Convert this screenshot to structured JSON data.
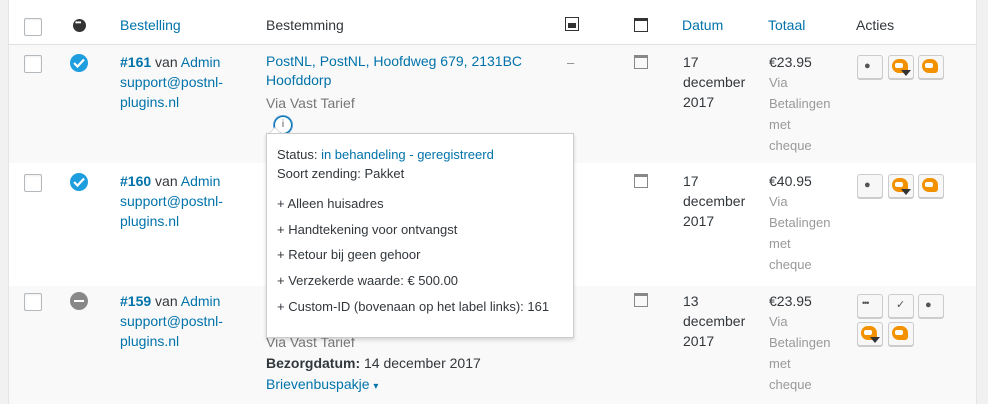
{
  "header": {
    "bestelling": "Bestelling",
    "bestemming": "Bestemming",
    "datum": "Datum",
    "totaal": "Totaal",
    "acties": "Acties"
  },
  "rows": [
    {
      "order_no": "#161",
      "van": "van",
      "customer": "Admin",
      "email_line1": "support@postnl-",
      "email_line2": "plugins.nl",
      "address_line1": "PostNL, PostNL, Hoofdweg 679, 2131BC",
      "address_line2": "Hoofddorp",
      "via": "Via Vast Tarief",
      "dash": "–",
      "date_line1": "17",
      "date_line2": "december",
      "date_line3": "2017",
      "total": "€23.95",
      "pay_line1": "Via",
      "pay_line2": "Betalingen",
      "pay_line3": "met",
      "pay_line4": "cheque"
    },
    {
      "order_no": "#160",
      "van": "van",
      "customer": "Admin",
      "email_line1": "support@postnl-",
      "email_line2": "plugins.nl",
      "date_line1": "17",
      "date_line2": "december",
      "date_line3": "2017",
      "total": "€40.95",
      "pay_line1": "Via",
      "pay_line2": "Betalingen",
      "pay_line3": "met",
      "pay_line4": "cheque"
    },
    {
      "order_no": "#159",
      "van": "van",
      "customer": "Admin",
      "email_line1": "support@postnl-",
      "email_line2": "plugins.nl",
      "via": "Via Vast Tarief",
      "bezorg_label": "Bezorgdatum:",
      "bezorg_value": " 14 december 2017",
      "package": "Brievenbuspakje",
      "package_caret": "▾",
      "date_line1": "13",
      "date_line2": "december",
      "date_line3": "2017",
      "total": "€23.95",
      "pay_line1": "Via",
      "pay_line2": "Betalingen",
      "pay_line3": "met",
      "pay_line4": "cheque"
    }
  ],
  "popup": {
    "status_label": "Status: ",
    "status_value": "in behandeling - geregistreerd",
    "soort": "Soort zending: Pakket",
    "opt1": "+ Alleen huisadres",
    "opt2": "+ Handtekening voor ontvangst",
    "opt3": "+ Retour bij geen gehoor",
    "opt4": "+ Verzekerde waarde: € 500.00",
    "opt5": "+ Custom-ID (bovenaan op het label links): 161"
  },
  "icons": {
    "info": "i",
    "eye": "👁",
    "check": "✓",
    "more": "•••"
  },
  "colors": {
    "link": "#0073aa",
    "postnl_orange": "#f39200",
    "status_ok": "#1e9ede"
  }
}
